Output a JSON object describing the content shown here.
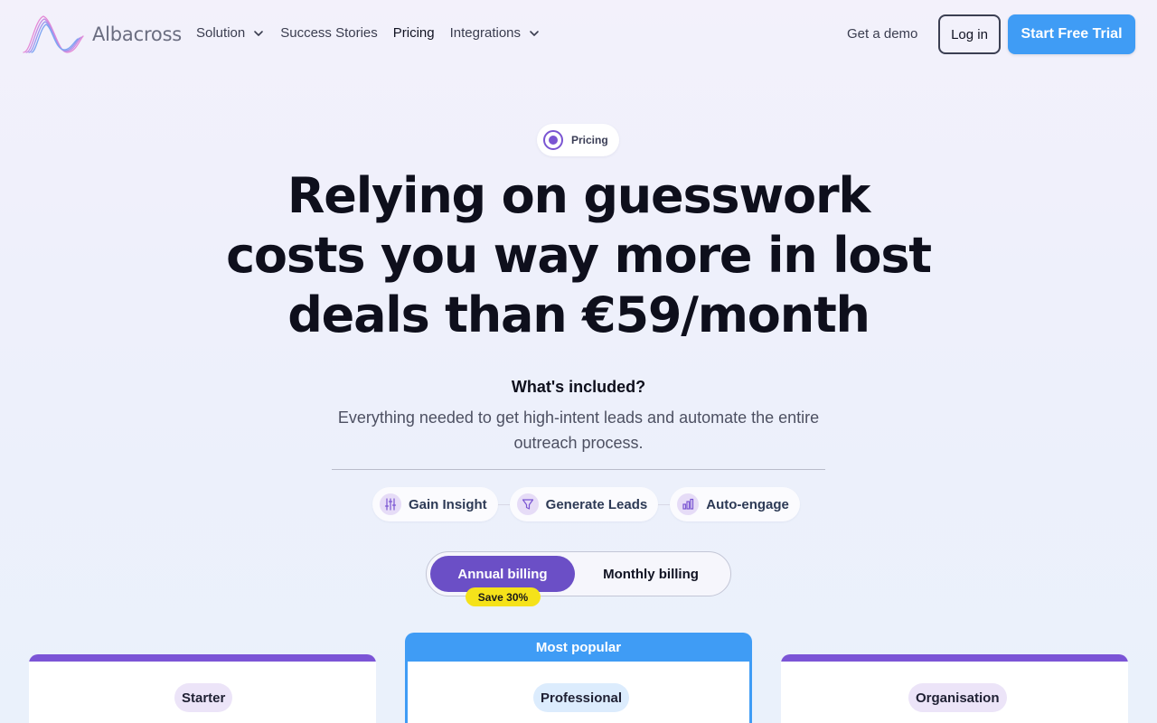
{
  "brand": {
    "name": "Albacross"
  },
  "nav": {
    "items": [
      {
        "label": "Solution",
        "has_dropdown": true
      },
      {
        "label": "Success Stories",
        "has_dropdown": false
      },
      {
        "label": "Pricing",
        "has_dropdown": false
      },
      {
        "label": "Integrations",
        "has_dropdown": true
      }
    ],
    "demo_label": "Get a demo",
    "login_label": "Log in",
    "trial_label": "Start Free Trial"
  },
  "hero": {
    "badge": "Pricing",
    "headline_lines": [
      "Relying on guesswork",
      "costs you way more in lost",
      "deals than €59/month"
    ],
    "included_title": "What's included?",
    "included_desc": "Everything needed to get high-intent leads and automate the entire outreach process."
  },
  "features": [
    {
      "label": "Gain Insight",
      "icon": "sliders-icon"
    },
    {
      "label": "Generate Leads",
      "icon": "funnel-icon"
    },
    {
      "label": "Auto-engage",
      "icon": "bar-chart-icon"
    }
  ],
  "billing": {
    "annual_label": "Annual billing",
    "monthly_label": "Monthly billing",
    "selected": "annual",
    "save_badge": "Save 30%"
  },
  "plans": [
    {
      "name": "Starter",
      "popular": false
    },
    {
      "name": "Professional",
      "popular": true,
      "popular_label": "Most popular"
    },
    {
      "name": "Organisation",
      "popular": false
    }
  ],
  "colors": {
    "accent_purple": "#6b4fc6",
    "accent_blue": "#3f9cf5",
    "save_yellow": "#f5e21a"
  }
}
